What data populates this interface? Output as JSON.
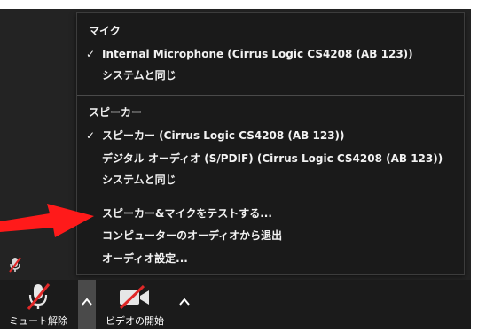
{
  "menu": {
    "mic_heading": "マイク",
    "mic_items": [
      {
        "label": "Internal Microphone (Cirrus Logic CS4208 (AB 123))",
        "checked": true
      },
      {
        "label": "システムと同じ",
        "checked": false
      }
    ],
    "speaker_heading": "スピーカー",
    "speaker_items": [
      {
        "label": "スピーカー (Cirrus Logic CS4208 (AB 123))",
        "checked": true
      },
      {
        "label": "デジタル オーディオ (S/PDIF) (Cirrus Logic CS4208 (AB 123))",
        "checked": false
      },
      {
        "label": "システムと同じ",
        "checked": false
      }
    ],
    "actions": [
      {
        "label": "スピーカー&マイクをテストする..."
      },
      {
        "label": "コンピューターのオーディオから退出"
      },
      {
        "label": "オーディオ設定..."
      }
    ],
    "check_mark": "✓"
  },
  "toolbar": {
    "unmute_label": "ミュート解除",
    "start_video_label": "ビデオの開始"
  },
  "colors": {
    "menu_bg": "#1a1a1a",
    "toolbar_bg": "#1b1b1b",
    "mute_slash": "#e02828",
    "annotation_arrow": "#ff1a1a"
  }
}
